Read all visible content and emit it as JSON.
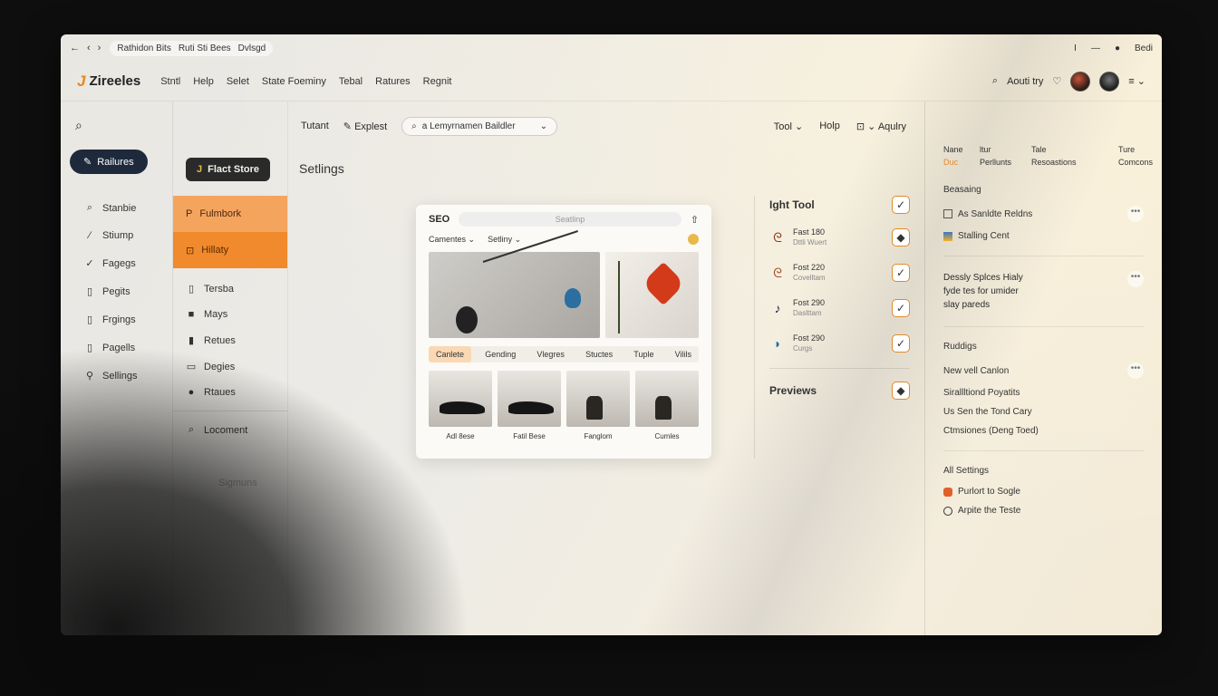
{
  "addressbar": {
    "nav": [
      "←",
      "‹",
      "›"
    ],
    "crumbs": [
      "Rathidon Bits",
      "Ruti Sti Bees",
      "Dvlsgd"
    ],
    "controls": [
      "I",
      "—",
      "●",
      "Bedi"
    ]
  },
  "topnav": {
    "logo_mark": "J",
    "logo_text": "Zireeles",
    "menu": [
      "Stntl",
      "Help",
      "Selet",
      "State Foeminy",
      "Tebal",
      "Ratures",
      "Regnit"
    ],
    "account_text": "Aouti try"
  },
  "sidebar": {
    "button_label": "Railures",
    "items": [
      {
        "icon": "⌕",
        "label": "Stanbie"
      },
      {
        "icon": "∕",
        "label": "Stiump"
      },
      {
        "icon": "✓",
        "label": "Fagegs"
      },
      {
        "icon": "▯",
        "label": "Pegits"
      },
      {
        "icon": "▯",
        "label": "Frgings"
      },
      {
        "icon": "▯",
        "label": "Pagells"
      },
      {
        "icon": "⚲",
        "label": "Sellings"
      }
    ]
  },
  "col2": {
    "button_label": "Flact Store",
    "orange_items": [
      {
        "icon": "P",
        "label": "Fulmbork"
      },
      {
        "icon": "⊡",
        "label": "Hillaty"
      }
    ],
    "items": [
      {
        "icon": "▯",
        "label": "Tersba"
      },
      {
        "icon": "■",
        "label": "Mays"
      },
      {
        "icon": "▮",
        "label": "Retues"
      },
      {
        "icon": "▭",
        "label": "Degies"
      },
      {
        "icon": "●",
        "label": "Rtaues"
      }
    ],
    "item_below": {
      "icon": "⌕",
      "label": "Locoment"
    },
    "faded_label": "Sigmuns"
  },
  "toolbar": {
    "tab1": "Tutant",
    "tab2": "Explest",
    "search_placeholder": "a Lemyrnamen Baildler",
    "right": [
      "Tool",
      "Holp",
      "Aqulry"
    ]
  },
  "page_title": "Setlings",
  "card": {
    "title": "SEO",
    "bar_text": "Seatlinp",
    "sub": [
      "Camentes",
      "Setliny"
    ],
    "chips": [
      "Canlete",
      "Gending",
      "Vlegres",
      "Stuctes",
      "Tuple",
      "Vilils"
    ],
    "active_chip": 0,
    "thumbs": [
      "Adl 8ese",
      "Fatil Bese",
      "Fanglom",
      "Cumles"
    ]
  },
  "toolpanel": {
    "title": "Ight Tool",
    "rows": [
      {
        "title": "Fast 180",
        "sub": "Dttli Wuert",
        "check": "◆"
      },
      {
        "title": "Fost 220",
        "sub": "Covelltam",
        "check": "✓"
      },
      {
        "title": "Fost 290",
        "sub": "Daslttam",
        "check": "✓"
      },
      {
        "title": "Fost 290",
        "sub": "Curgs",
        "check": "✓"
      }
    ],
    "previews_label": "Previews",
    "previews_check": "◆"
  },
  "rpanel": {
    "table_header": [
      "Nane",
      "ltur",
      "Tale",
      "Ture"
    ],
    "table_row": [
      "Duc",
      "Perllunts",
      "Resoastions",
      "Comcons"
    ],
    "sec1_title": "Beasaing",
    "sec1_items": [
      "As Sanldte Reldns",
      "Stalling Cent"
    ],
    "desc": "Dessly Splces Hialy fyde tes for umider slay pareds",
    "sec3_title": "Ruddigs",
    "sec3_items": [
      "New vell Canlon",
      "Sirallltiond Poyatits",
      "Us Sen the Tond Cary",
      "Ctmsiones (Deng Toed)"
    ],
    "sec4_title": "All Settings",
    "sec4_items": [
      "Purlort to Sogle",
      "Arpite the Teste"
    ],
    "more": "•••"
  },
  "colors": {
    "accent": "#f08a2c",
    "accent_light": "#f5a45e",
    "dark_button": "#1e2a3c"
  }
}
